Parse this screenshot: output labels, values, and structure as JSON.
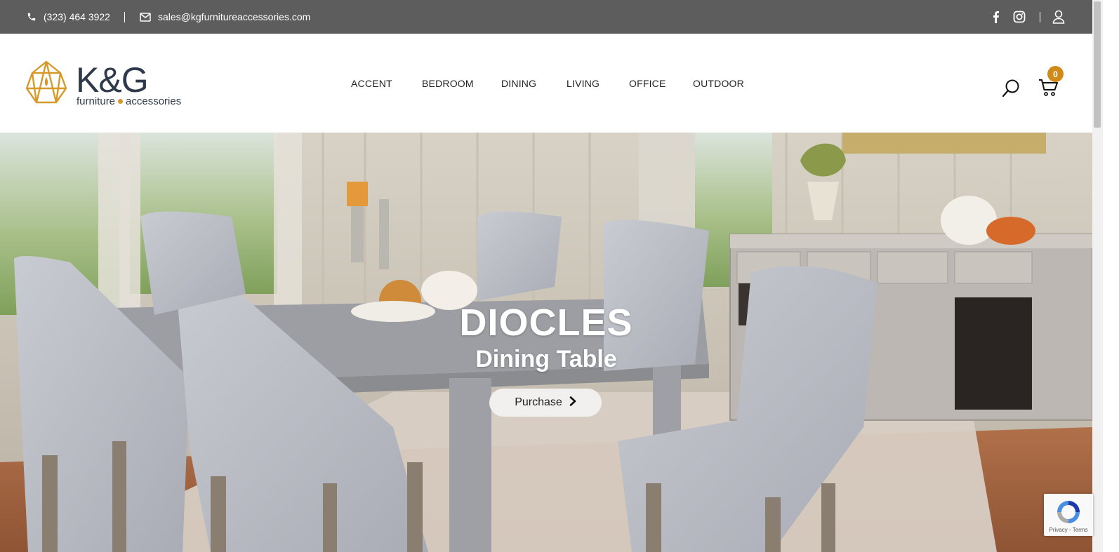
{
  "topbar": {
    "phone": "(323) 464 3922",
    "email": "sales@kgfurnitureaccessories.com",
    "icons": [
      "phone-icon",
      "mail-icon",
      "facebook-icon",
      "instagram-icon",
      "user-icon"
    ]
  },
  "logo": {
    "word": "K&G",
    "tag_left": "furniture",
    "tag_right": "accessories"
  },
  "nav": {
    "items": [
      "ACCENT",
      "BEDROOM",
      "DINING",
      "LIVING",
      "OFFICE",
      "OUTDOOR"
    ]
  },
  "cart": {
    "count": "0"
  },
  "hero": {
    "title": "DIOCLES",
    "subtitle": "Dining Table",
    "button_label": "Purchase"
  },
  "recaptcha": {
    "text": "Privacy - Terms"
  },
  "colors": {
    "topbar": "#5d5d5d",
    "accent": "#d08a1a",
    "logo_text": "#2e3a4b"
  }
}
